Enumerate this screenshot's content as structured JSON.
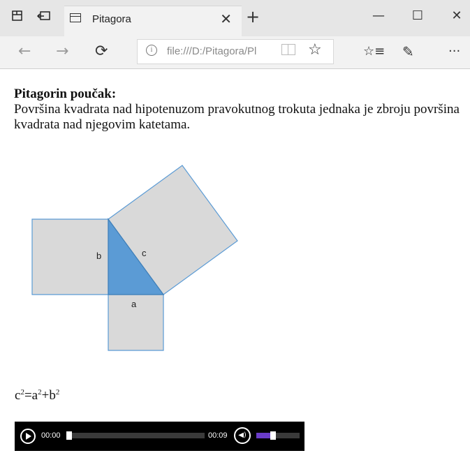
{
  "browser": {
    "tab_title": "Pitagora",
    "tab_close": "✕",
    "new_tab": "+",
    "address": "file:///D:/Pitagora/Pl",
    "window_buttons": {
      "minimize": "—",
      "maximize": "☐",
      "close": "✕"
    },
    "icons": {
      "tab_preview": "tab-preview-icon",
      "set_aside": "set-aside-icon",
      "back": "←",
      "forward": "→",
      "refresh": "⟳",
      "favorites": "☆",
      "favorites_hub": "☆≡",
      "notes": "✎",
      "more": "···"
    }
  },
  "page": {
    "heading": "Pitagorin poučak:",
    "text": "Površina kvadrata nad hipotenuzom pravokutnog trokuta jednaka je zbroju površina kvadrata nad njegovim katetama.",
    "diagram_labels": {
      "a": "a",
      "b": "b",
      "c": "c"
    },
    "formula": {
      "c": "c",
      "eq": "=",
      "a": "a",
      "plus": "+",
      "b": "b",
      "exp": "2"
    }
  },
  "player": {
    "current_time": "00:00",
    "duration": "00:09",
    "progress": 0,
    "volume": 0.33
  },
  "colors": {
    "square_fill": "#d9d9d9",
    "square_stroke": "#5b9bd5",
    "triangle_fill": "#5b9bd5",
    "volume_fill": "#6a3cc8"
  }
}
